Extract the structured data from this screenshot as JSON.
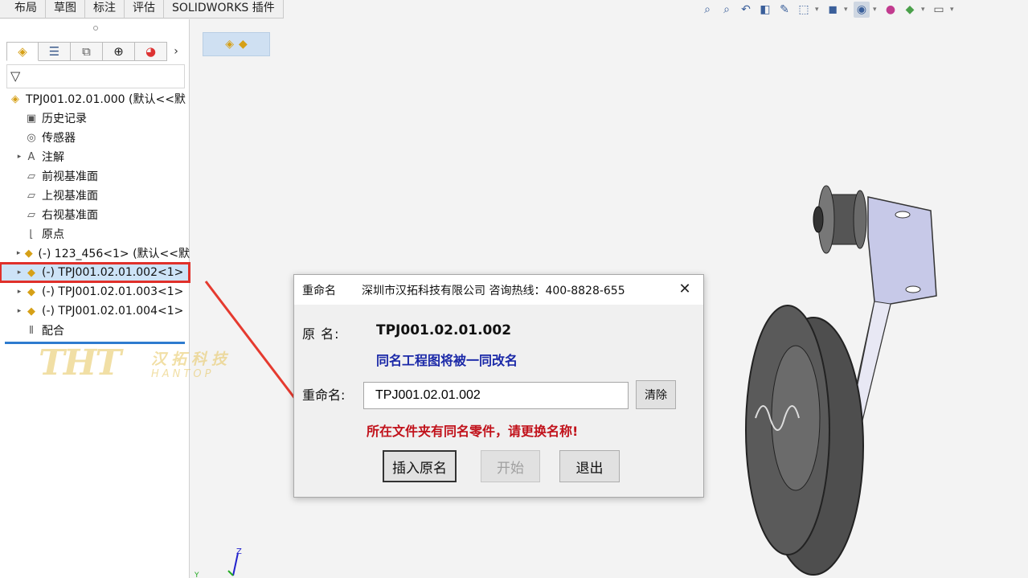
{
  "command_tabs": [
    "布局",
    "草图",
    "标注",
    "评估",
    "SOLIDWORKS 插件"
  ],
  "feature_tree": {
    "root": "TPJ001.02.01.000 (默认<<默",
    "items": [
      {
        "label": "历史记录",
        "icon": "history-icon",
        "expandable": false
      },
      {
        "label": "传感器",
        "icon": "sensor-icon",
        "expandable": false
      },
      {
        "label": "注解",
        "icon": "annotation-icon",
        "expandable": true
      },
      {
        "label": "前视基准面",
        "icon": "plane-icon",
        "expandable": false
      },
      {
        "label": "上视基准面",
        "icon": "plane-icon",
        "expandable": false
      },
      {
        "label": "右视基准面",
        "icon": "plane-icon",
        "expandable": false
      },
      {
        "label": "原点",
        "icon": "origin-icon",
        "expandable": false
      },
      {
        "label": "(-) 123_456<1> (默认<<默",
        "icon": "part-icon",
        "expandable": true
      },
      {
        "label": "(-) TPJ001.02.01.002<1>",
        "icon": "part-icon",
        "expandable": true,
        "selected": true
      },
      {
        "label": "(-) TPJ001.02.01.003<1>",
        "icon": "part-icon",
        "expandable": true
      },
      {
        "label": "(-) TPJ001.02.01.004<1>",
        "icon": "part-icon",
        "expandable": true
      },
      {
        "label": "配合",
        "icon": "mate-icon",
        "expandable": false
      }
    ]
  },
  "watermark": {
    "logo": "THT",
    "cn": "汉拓科技",
    "en": "HANTOP"
  },
  "dialog": {
    "title": "重命名",
    "company": "深圳市汉拓科技有限公司  咨询热线：400-8828-655",
    "orig_label": "原   名:",
    "orig_value": "TPJ001.02.01.002",
    "note": "同名工程图将被一同改名",
    "rename_label": "重命名:",
    "rename_value": "TPJ001.02.01.002",
    "clear_btn": "清除",
    "warning": "所在文件夹有同名零件，请更换名称!",
    "insert_btn": "插入原名",
    "start_btn": "开始",
    "exit_btn": "退出"
  },
  "triad": {
    "z": "Z",
    "y": "Y"
  },
  "colors": {
    "accent": "#2e7bcf",
    "highlight_box": "#e0302a",
    "warning": "#c1121b",
    "note": "#1b29a8",
    "selection": "#cde3f7"
  }
}
